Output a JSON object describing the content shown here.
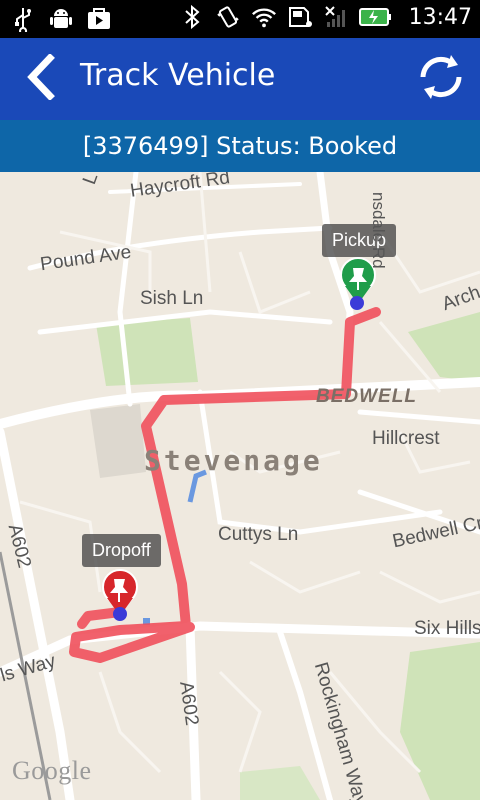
{
  "status_bar": {
    "time": "13:47",
    "left_icons": [
      "usb-icon",
      "android-debug-icon",
      "media-icon"
    ],
    "right_icons": [
      "bluetooth-icon",
      "vibrate-icon",
      "wifi-icon",
      "sd-card-icon",
      "no-signal-icon",
      "battery-charging-icon"
    ]
  },
  "app_bar": {
    "title": "Track Vehicle",
    "back_icon": "chevron-left-icon",
    "refresh_icon": "refresh-icon",
    "color": "#1a49b8"
  },
  "status_line": {
    "text": "[3376499] Status: Booked",
    "color": "#0e66a8"
  },
  "map": {
    "route_color": "#f0505c",
    "markers": {
      "pickup": {
        "label": "Pickup",
        "color": "#1f9d4a"
      },
      "dropoff": {
        "label": "Dropoff",
        "color": "#d7262b"
      }
    },
    "labels": {
      "haycroft": "Haycroft Rd",
      "pound": "Pound Ave",
      "sish": "Sish Ln",
      "bedwell": "BEDWELL",
      "hillcrest": "Hillcrest",
      "stevenage": "Stevenage",
      "cuttys": "Cuttys Ln",
      "bedwellcr": "Bedwell Cr",
      "sixhills": "Six Hills",
      "a602_left": "A602",
      "a602_bottom": "A602",
      "lsway": "ls Way",
      "rockingham": "Rockingham Way",
      "archer": "Arch",
      "lonsdale": "nsdale Rd",
      "top_l": "L"
    },
    "attribution": "Google"
  }
}
